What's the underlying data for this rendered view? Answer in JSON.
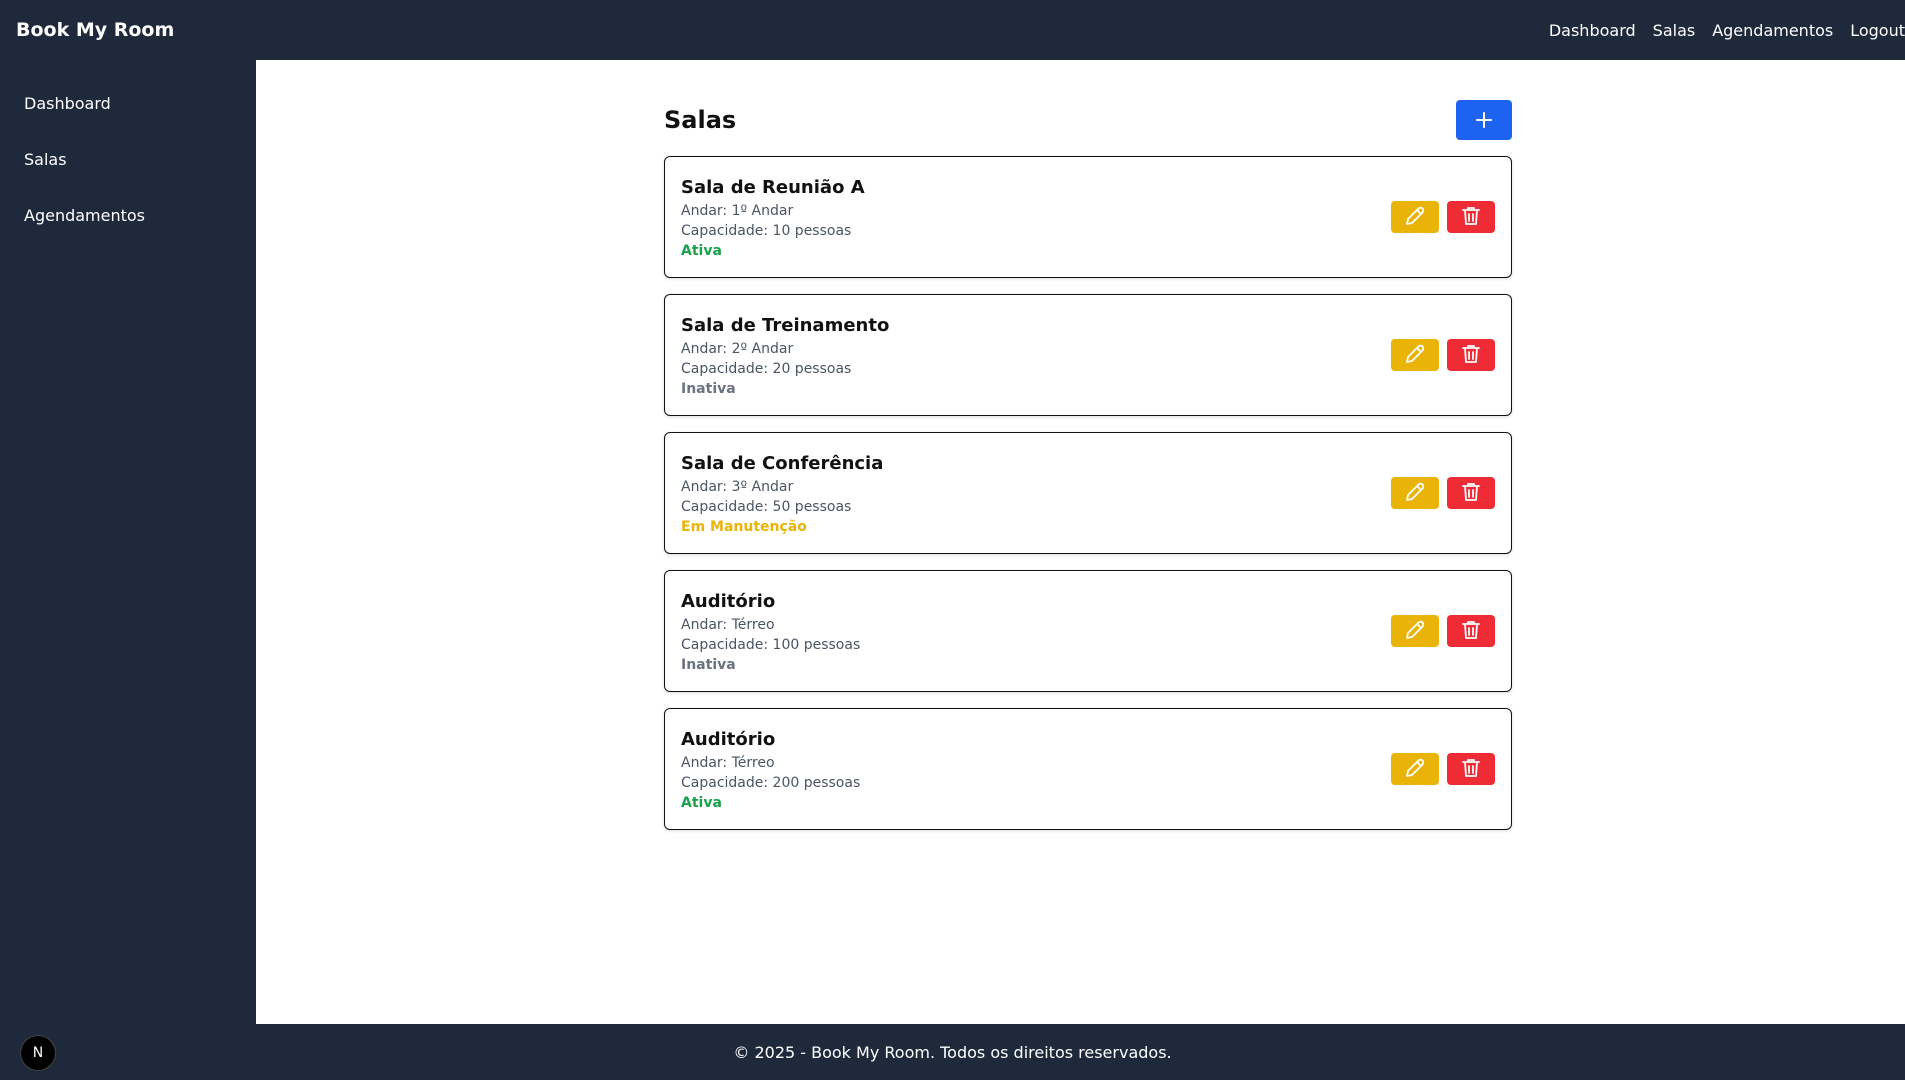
{
  "app": {
    "brand": "Book My Room"
  },
  "topnav": {
    "dashboard": "Dashboard",
    "salas": "Salas",
    "agendamentos": "Agendamentos",
    "logout": "Logout"
  },
  "sidebar": {
    "items": [
      {
        "label": "Dashboard"
      },
      {
        "label": "Salas"
      },
      {
        "label": "Agendamentos"
      }
    ]
  },
  "page": {
    "title": "Salas",
    "add_icon": "plus-icon"
  },
  "colors": {
    "active": "#16a34a",
    "inactive": "#6b7280",
    "maintenance": "#eab308",
    "primary": "#1d63f2",
    "edit": "#eab308",
    "delete": "#ef2b35",
    "nav_bg": "#1e293b"
  },
  "rooms": [
    {
      "name": "Sala de Reunião A",
      "floor": "Andar: 1º Andar",
      "capacity": "Capacidade: 10 pessoas",
      "status": "Ativa",
      "status_color": "#16a34a"
    },
    {
      "name": "Sala de Treinamento",
      "floor": "Andar: 2º Andar",
      "capacity": "Capacidade: 20 pessoas",
      "status": "Inativa",
      "status_color": "#6b7280"
    },
    {
      "name": "Sala de Conferência",
      "floor": "Andar: 3º Andar",
      "capacity": "Capacidade: 50 pessoas",
      "status": "Em Manutenção",
      "status_color": "#eab308"
    },
    {
      "name": "Auditório",
      "floor": "Andar: Térreo",
      "capacity": "Capacidade: 100 pessoas",
      "status": "Inativa",
      "status_color": "#6b7280"
    },
    {
      "name": "Auditório",
      "floor": "Andar: Térreo",
      "capacity": "Capacidade: 200 pessoas",
      "status": "Ativa",
      "status_color": "#16a34a"
    }
  ],
  "footer": {
    "text": "© 2025 - Book My Room. Todos os direitos reservados."
  },
  "badge": {
    "letter": "N"
  }
}
